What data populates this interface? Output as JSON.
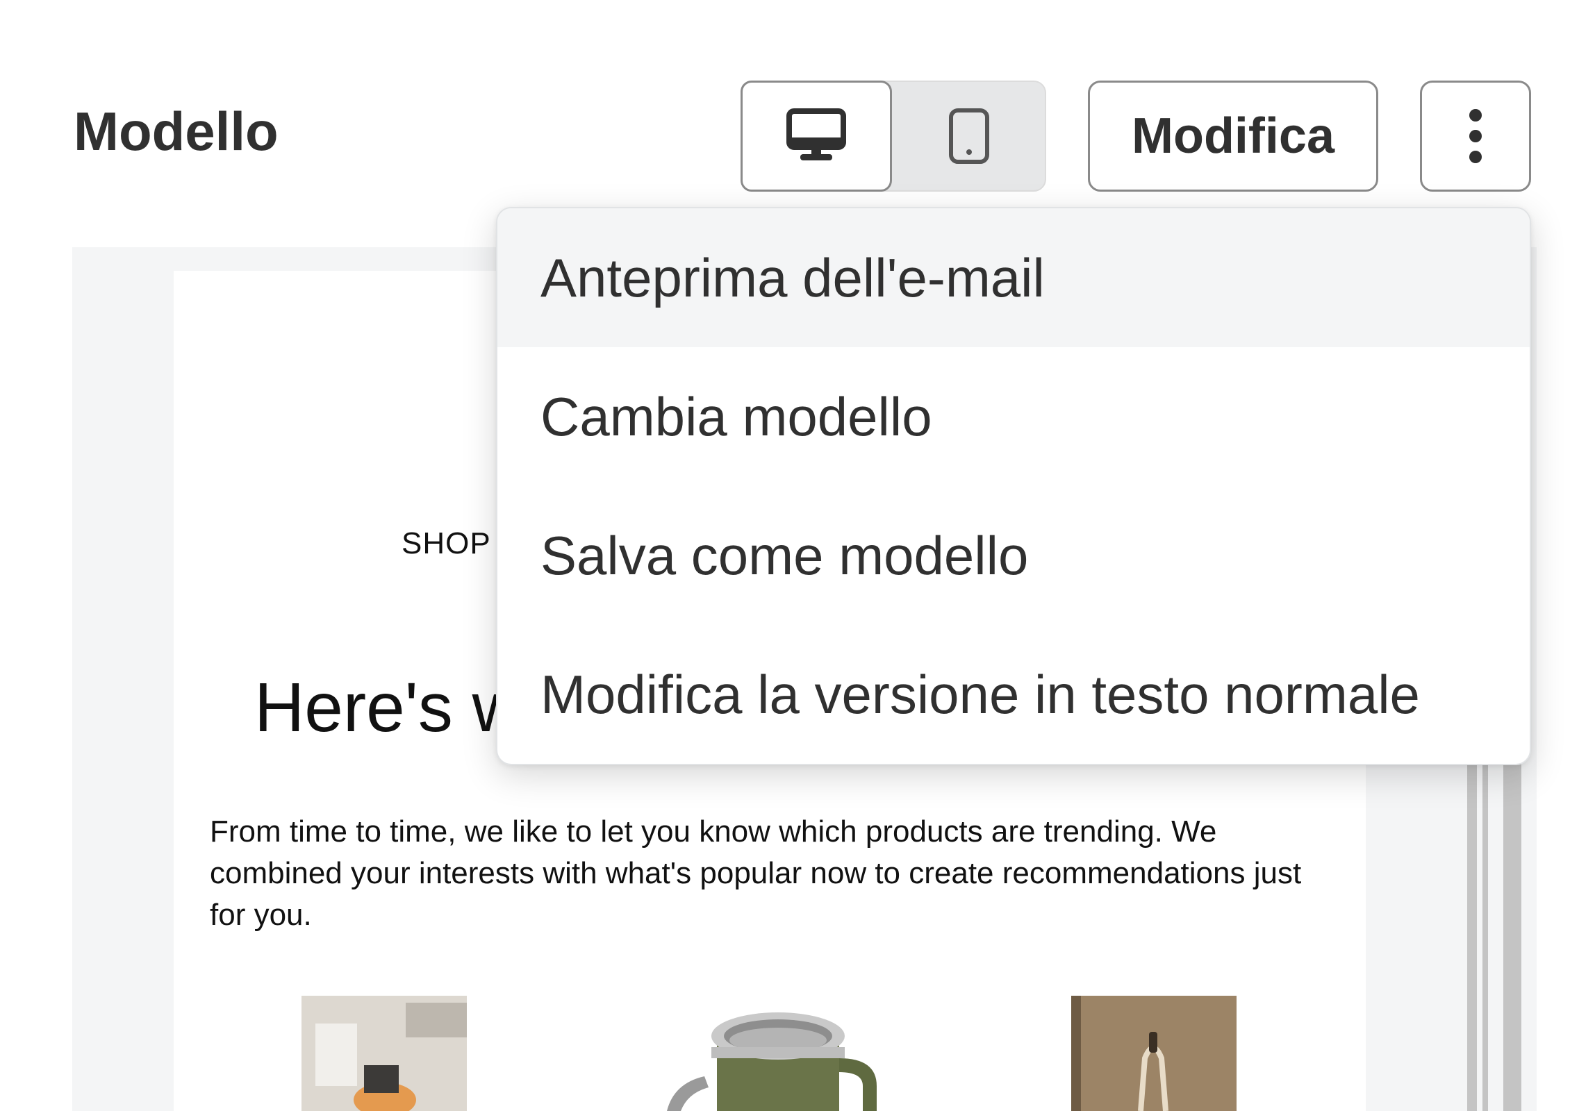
{
  "header": {
    "title": "Modello",
    "view_toggle": {
      "desktop_icon": "desktop-icon",
      "mobile_icon": "mobile-icon",
      "selected": "desktop"
    },
    "edit_label": "Modifica",
    "more_icon": "more-vertical-icon"
  },
  "menu": {
    "items": [
      {
        "label": "Anteprima dell'e-mail",
        "highlighted": true
      },
      {
        "label": "Cambia modello"
      },
      {
        "label": "Salva come modello"
      },
      {
        "label": "Modifica la versione in testo normale"
      }
    ]
  },
  "email_preview": {
    "shop_label": "SHOP",
    "headline": "Here's w",
    "body": "From time to time, we like to let you know which products are trending. We combined your interests with what's popular now to create recommendations just for you."
  },
  "colors": {
    "text": "#303030",
    "preview_background": "#f4f5f6",
    "border": "#8a8a8a"
  }
}
